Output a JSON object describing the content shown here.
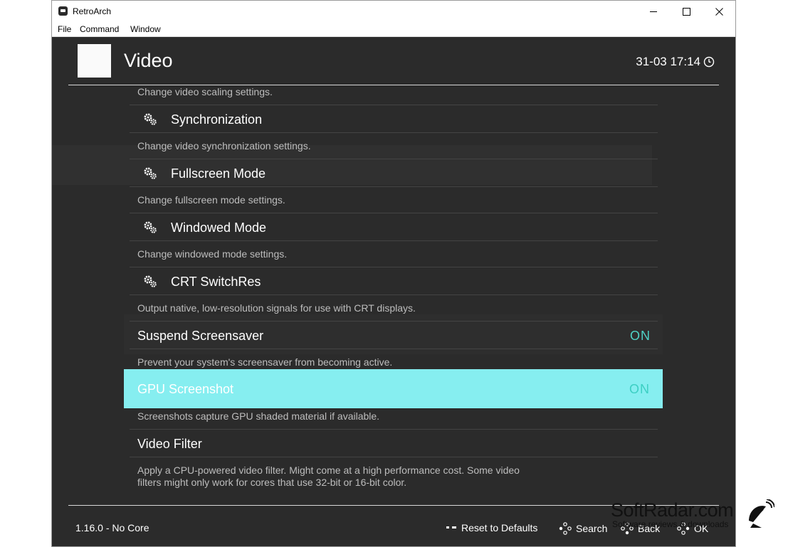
{
  "window": {
    "title": "RetroArch",
    "menu": [
      "File",
      "Command",
      "Window"
    ]
  },
  "header": {
    "title": "Video",
    "clock": "31-03 17:14"
  },
  "items": {
    "top_desc": "Change video scaling settings.",
    "synchronization": {
      "label": "Synchronization",
      "desc": "Change video synchronization settings."
    },
    "fullscreen": {
      "label": "Fullscreen Mode",
      "desc": "Change fullscreen mode settings."
    },
    "windowed": {
      "label": "Windowed Mode",
      "desc": "Change windowed mode settings."
    },
    "crt": {
      "label": "CRT SwitchRes",
      "desc": "Output native, low-resolution signals for use with CRT displays."
    },
    "suspend": {
      "label": "Suspend Screensaver",
      "value": "ON",
      "desc": "Prevent your system's screensaver from becoming active."
    },
    "gpu_screenshot": {
      "label": "GPU Screenshot",
      "value": "ON",
      "desc": "Screenshots capture GPU shaded material if available."
    },
    "video_filter": {
      "label": "Video Filter",
      "desc_line1": "Apply a CPU-powered video filter. Might come at a high performance cost. Some video",
      "desc_line2": "filters might only work for cores that use 32-bit or 16-bit color."
    }
  },
  "footer": {
    "version": "1.16.0 - No Core",
    "hints": {
      "reset": "Reset to Defaults",
      "search": "Search",
      "back": "Back",
      "ok": "OK"
    }
  },
  "watermark": {
    "name": "SoftRadar.com",
    "tagline": "Software reviews & downloads"
  },
  "colors": {
    "background": "#2b2b2b",
    "selection": "#86eef0",
    "toggle_on": "#4fd1c5"
  }
}
